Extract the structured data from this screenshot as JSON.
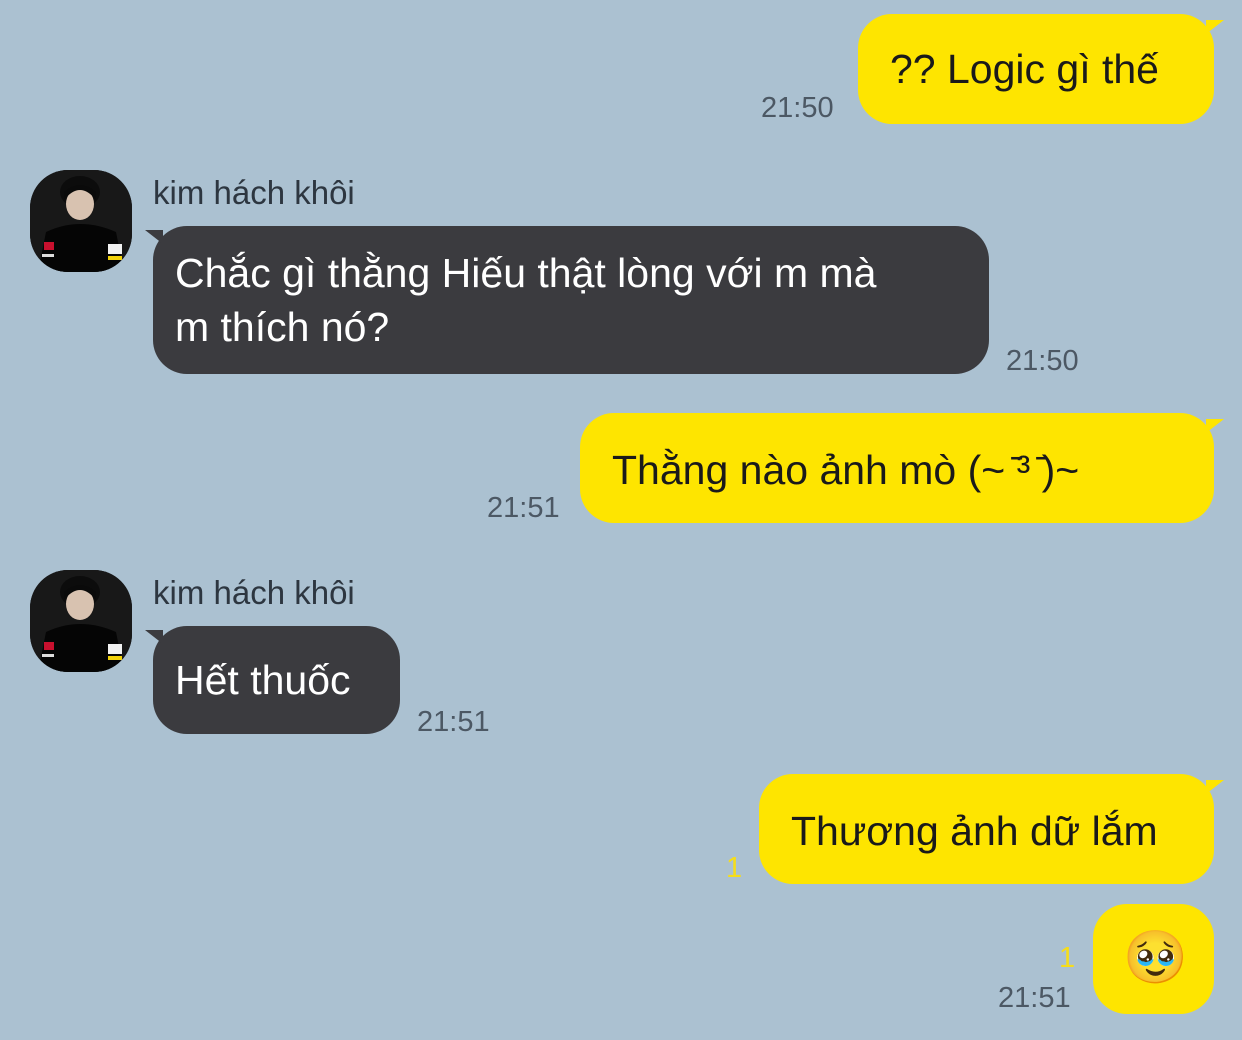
{
  "messages": [
    {
      "side": "out",
      "text": "?? Logic gì thế",
      "time": "21:50"
    },
    {
      "side": "in",
      "sender": "kim hách khôi",
      "avatar": "user-photo-avatar",
      "lines": [
        "Chắc gì thằng Hiếu thật lòng với m mà",
        "m thích nó?"
      ],
      "time": "21:50"
    },
    {
      "side": "out",
      "text": "Thằng nào ảnh mò (~ ̄³ ̄)~",
      "time": "21:51"
    },
    {
      "side": "in",
      "sender": "kim hách khôi",
      "avatar": "user-photo-avatar",
      "text": "Hết thuốc",
      "time": "21:51"
    },
    {
      "side": "out",
      "text": "Thương ảnh dữ lắm",
      "unread": "1"
    },
    {
      "side": "out",
      "emoji": "🥹",
      "emoji_name": "face-holding-back-tears-icon",
      "unread": "1",
      "time": "21:51"
    }
  ],
  "colors": {
    "background": "#abc1d1",
    "outgoing_bubble": "#fee500",
    "incoming_bubble": "#3b3b3f",
    "unread_count": "#f6dd1a"
  }
}
